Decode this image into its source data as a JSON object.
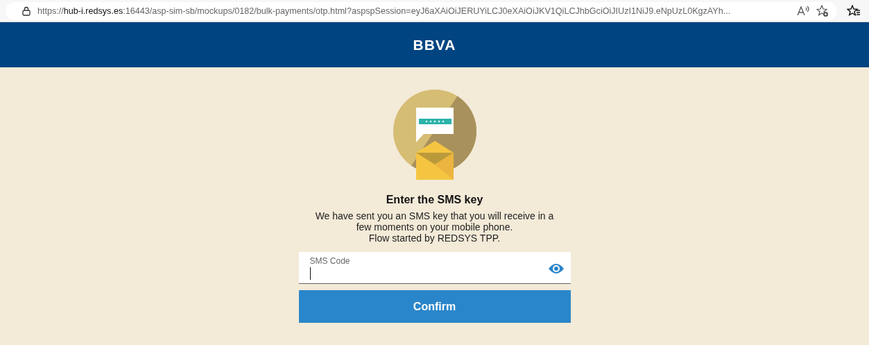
{
  "browser": {
    "url": "https://**hub-i.redsys.es**:16443/asp-sim-sb/mockups/0182/bulk-payments/otp.html?aspspSession=eyJ6aXAiOiJERUYiLCJ0eXAiOiJKV1QiLCJhbGciOiJIUzI1NiJ9.eNpUzL0KgzAYh..."
  },
  "header": {
    "logo": "BBVA"
  },
  "content": {
    "title": "Enter the SMS key",
    "description": "We have sent you an SMS key that you will receive in a\nfew moments on your mobile phone.\nFlow started by REDSYS TPP.",
    "field": {
      "label": "SMS Code",
      "focused": true
    },
    "button": "Confirm"
  }
}
